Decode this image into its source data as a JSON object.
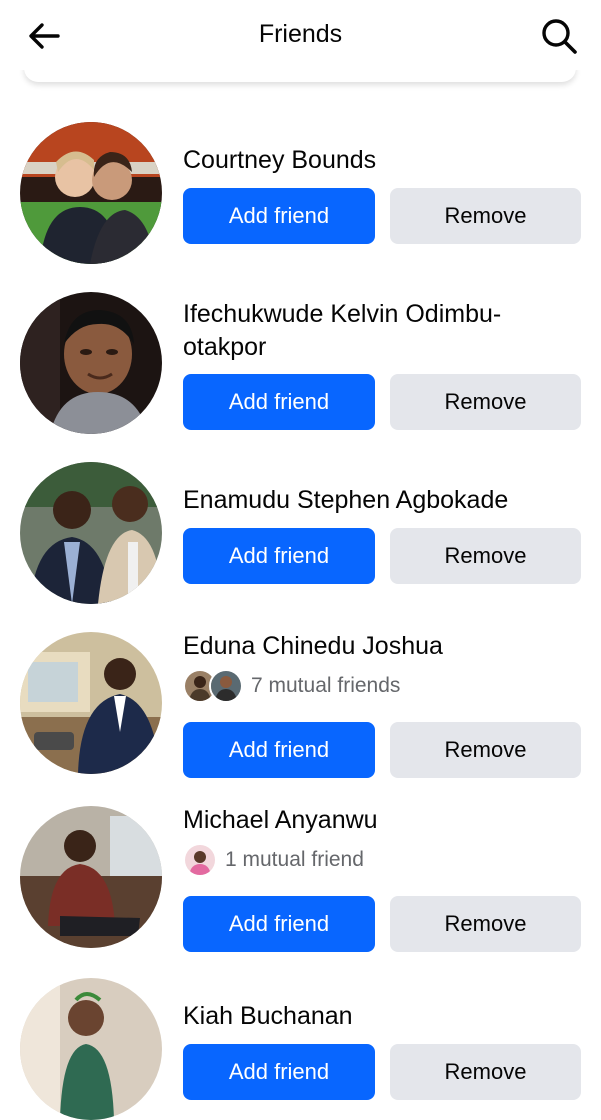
{
  "header": {
    "title": "Friends",
    "back_icon": "arrow-left-icon",
    "search_icon": "search-icon"
  },
  "colors": {
    "primary": "#0866ff",
    "secondary_button": "#e4e6eb",
    "muted_text": "#65676b"
  },
  "requests": [
    {
      "name": "Courtney Bounds",
      "add_label": "Add friend",
      "remove_label": "Remove"
    },
    {
      "name": "Ifechukwude Kelvin Odimbu-otakpor",
      "add_label": "Add friend",
      "remove_label": "Remove"
    },
    {
      "name": "Enamudu Stephen Agbokade",
      "add_label": "Add friend",
      "remove_label": "Remove"
    },
    {
      "name": "Eduna Chinedu Joshua",
      "mutual": "7 mutual friends",
      "add_label": "Add friend",
      "remove_label": "Remove"
    },
    {
      "name": "Michael Anyanwu",
      "mutual": "1 mutual friend",
      "add_label": "Add friend",
      "remove_label": "Remove"
    },
    {
      "name": "Kiah Buchanan",
      "add_label": "Add friend",
      "remove_label": "Remove"
    }
  ]
}
